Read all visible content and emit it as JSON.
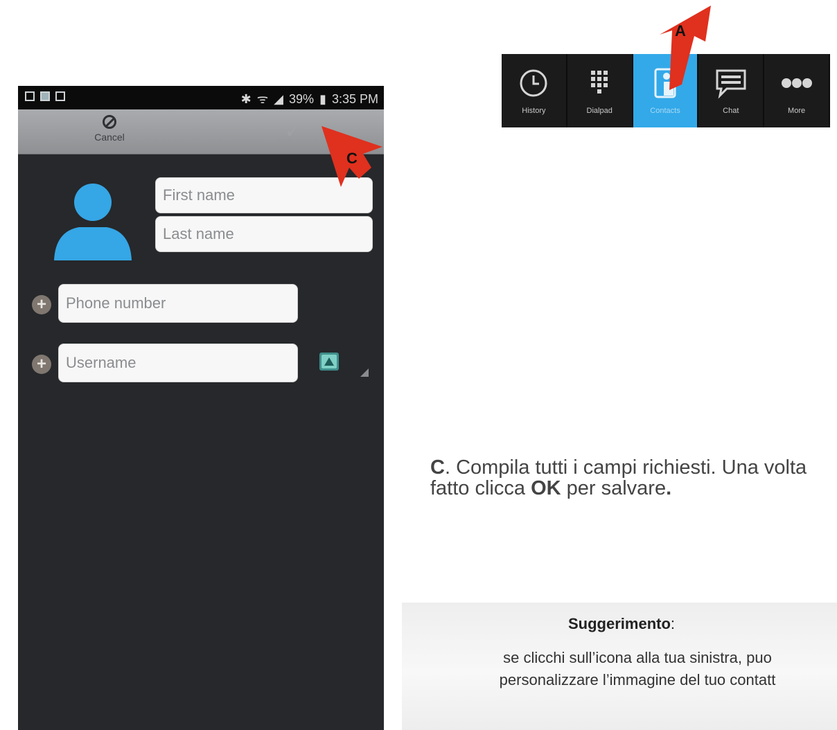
{
  "phone": {
    "status": {
      "battery": "39%",
      "time": "3:35 PM"
    },
    "actionbar": {
      "cancel_label": "Cancel"
    },
    "form": {
      "first_name_placeholder": "First name",
      "last_name_placeholder": "Last name",
      "phone_placeholder": "Phone number",
      "username_placeholder": "Username"
    }
  },
  "callouts": {
    "a": "A",
    "c": "C"
  },
  "nav": {
    "items": [
      {
        "label": "History",
        "icon": "history-icon",
        "active": false
      },
      {
        "label": "Dialpad",
        "icon": "dialpad-icon",
        "active": false
      },
      {
        "label": "Contacts",
        "icon": "contacts-icon",
        "active": true
      },
      {
        "label": "Chat",
        "icon": "chat-icon",
        "active": false
      },
      {
        "label": "More",
        "icon": "more-icon",
        "active": false
      }
    ]
  },
  "instruction": {
    "letter": "C",
    "text1": ". Compila tutti i campi richiesti. Una volta fatto clicca ",
    "ok": "OK",
    "text2": " per salvare",
    "end": "."
  },
  "tip": {
    "title": "Suggerimento",
    "colon": ":",
    "line1": "se clicchi sull’icona alla tua sinistra, puo",
    "line2": "personalizzare l’immagine del tuo contatt"
  },
  "colors": {
    "accent": "#33a9e9",
    "arrow": "#e0301e",
    "phone_bg": "#26282b"
  }
}
